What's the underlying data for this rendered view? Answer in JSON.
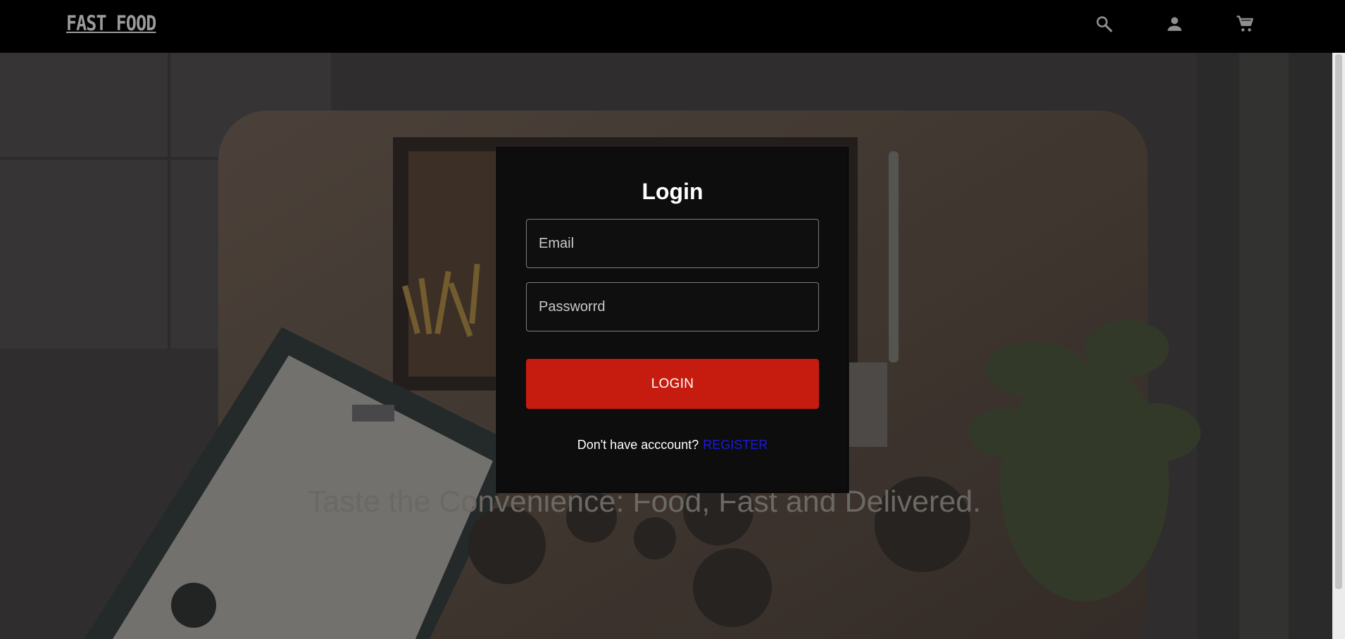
{
  "brand": {
    "name": "FAST FOOD"
  },
  "nav": {
    "icons": [
      "search-icon",
      "user-icon",
      "cart-icon"
    ],
    "icon_color": "#8f8f8f"
  },
  "hero": {
    "tagline": "Taste the Convenience: Food, Fast and Delivered."
  },
  "login": {
    "title": "Login",
    "email_placeholder": "Email",
    "password_placeholder": "Passworrd",
    "button_label": "LOGIN",
    "register_prompt": "Don't have acccount?",
    "register_link": "REGISTER"
  },
  "colors": {
    "accent": "#c61c10",
    "link": "#1a1ad9",
    "navbar": "#000000",
    "modal": "#0d0d0d"
  }
}
